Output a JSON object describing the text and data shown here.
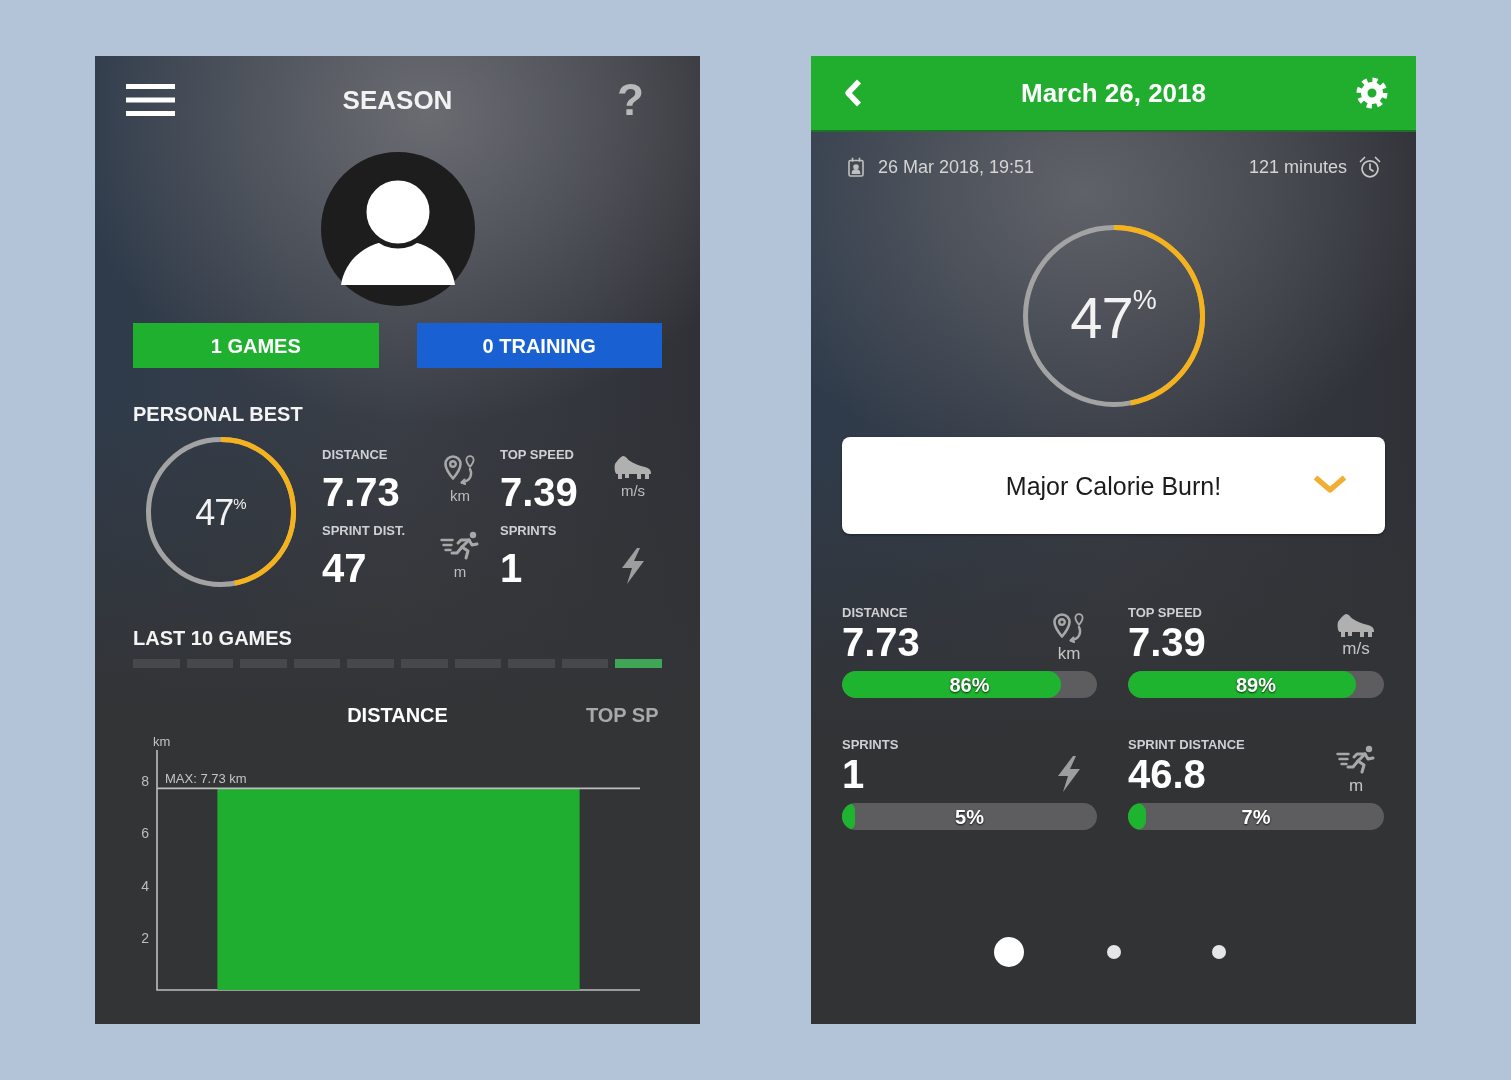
{
  "season": {
    "title": "SEASON",
    "help": "?",
    "buttons": [
      {
        "label": "1 GAMES",
        "kind": "games"
      },
      {
        "label": "0 TRAINING",
        "kind": "training"
      }
    ],
    "personal_best": {
      "title": "PERSONAL BEST",
      "ring": {
        "text": "47$^{%}$",
        "level": 0.47
      },
      "stats": [
        {
          "kind": "distance",
          "label": "DISTANCE",
          "value": "7.73",
          "unit": "km"
        },
        {
          "kind": "speed",
          "label": "TOP SPEED",
          "value": "7.39",
          "unit": "m/s"
        },
        {
          "kind": "sprintdistance",
          "label": "SPRINT DIST.",
          "value": "47",
          "unit": "m"
        },
        {
          "kind": "sprints",
          "label": "SPRINTS",
          "value": "1"
        }
      ]
    },
    "last_games": {
      "title": "LAST 10 GAMES",
      "games": [
        {
          "selected": false
        },
        {
          "selected": false
        },
        {
          "selected": false
        },
        {
          "selected": false
        },
        {
          "selected": false
        },
        {
          "selected": false
        },
        {
          "selected": false
        },
        {
          "selected": false
        },
        {
          "selected": false
        },
        {
          "selected": true
        }
      ]
    },
    "chart_tabs": [
      {
        "label": "DISTANCE",
        "selected": true
      },
      {
        "label": "TOP SP",
        "selected": false
      }
    ],
    "chart_data": {
      "type": "bar",
      "ylabel": "km",
      "values": [
        7.73
      ],
      "ylim": [
        0,
        9.2
      ],
      "yticks": [
        2,
        4,
        6,
        8
      ],
      "ref_lines": [
        {
          "axis": "y",
          "value": 7.73,
          "label": "MAX: 7.73 km"
        }
      ]
    }
  },
  "game": {
    "title": "March 26, 2018",
    "date": "26 Mar 2018, 19:51",
    "duration": "121 minutes",
    "ring": {
      "text": "47$^{%}$",
      "level": 0.47
    },
    "message": "Major Calorie Burn!",
    "stats": [
      {
        "kind": "distance",
        "label": "DISTANCE",
        "value": "7.73",
        "unit": "km",
        "level": 0.86,
        "percent": "86%"
      },
      {
        "kind": "speed",
        "label": "TOP SPEED",
        "value": "7.39",
        "unit": "m/s",
        "level": 0.89,
        "percent": "89%"
      },
      {
        "kind": "sprints",
        "label": "SPRINTS",
        "value": "1",
        "level": 0.05,
        "percent": "5%"
      },
      {
        "kind": "sprintdistance",
        "label": "SPRINT DISTANCE",
        "value": "46.8",
        "unit": "m",
        "level": 0.07,
        "percent": "7%"
      }
    ],
    "pages": [
      {
        "selected": true
      },
      {
        "selected": false
      },
      {
        "selected": false
      }
    ]
  }
}
